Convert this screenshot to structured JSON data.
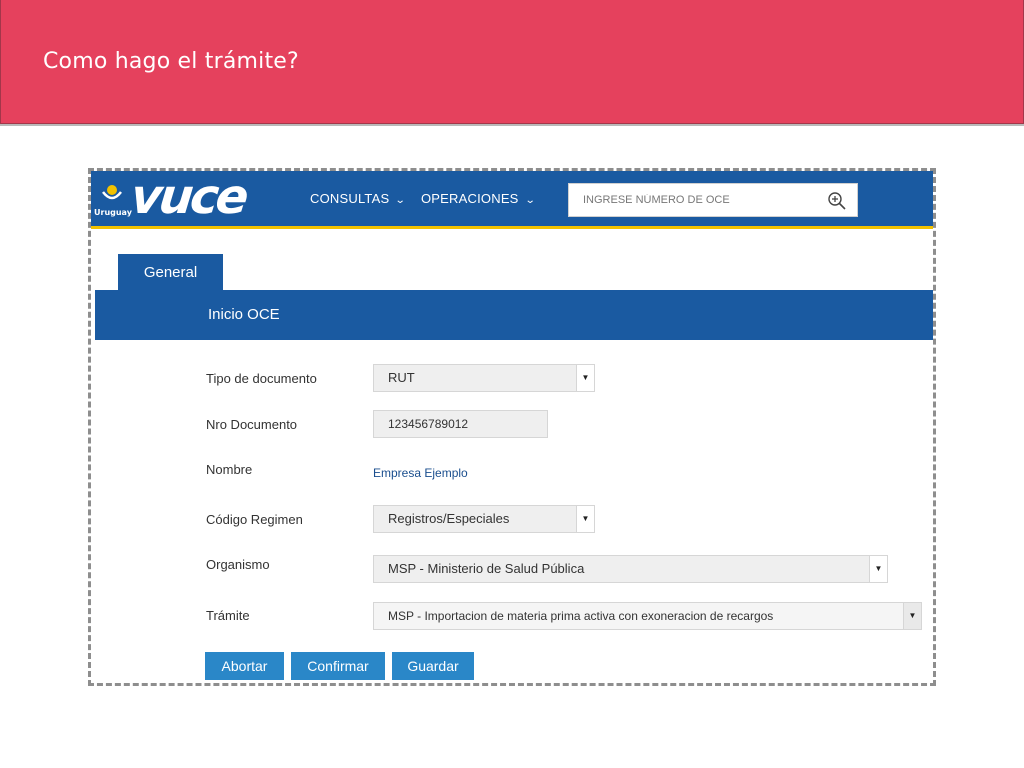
{
  "slide": {
    "title": "Como hago el trámite?"
  },
  "app": {
    "logo_text": "vuce",
    "logo_country": "Uruguay",
    "nav": [
      {
        "label": "CONSULTAS"
      },
      {
        "label": "OPERACIONES"
      }
    ],
    "search": {
      "placeholder": "INGRESE NÚMERO DE OCE",
      "value": ""
    },
    "tab": {
      "label": "General"
    },
    "section_title": "Inicio OCE"
  },
  "form": {
    "tipo_documento": {
      "label": "Tipo de documento",
      "value": "RUT"
    },
    "nro_documento": {
      "label": "Nro Documento",
      "value": "123456789012"
    },
    "nombre": {
      "label": "Nombre",
      "value": "Empresa Ejemplo"
    },
    "codigo_regimen": {
      "label": "Código Regimen",
      "value": "Registros/Especiales"
    },
    "organismo": {
      "label": "Organismo",
      "value": "MSP - Ministerio de Salud Pública"
    },
    "tramite": {
      "label": "Trámite",
      "value": "MSP - Importacion de materia prima activa con exoneracion de recargos"
    }
  },
  "buttons": {
    "abortar": "Abortar",
    "confirmar": "Confirmar",
    "guardar": "Guardar"
  },
  "colors": {
    "header_red": "#e5415d",
    "brand_blue": "#1a5aa1",
    "accent_yellow": "#f2c200",
    "button_blue": "#2a87c8"
  },
  "icons": {
    "search": "zoom-in-icon",
    "dropdown": "triangle-down-icon",
    "emblem": "sun-emblem-icon"
  }
}
